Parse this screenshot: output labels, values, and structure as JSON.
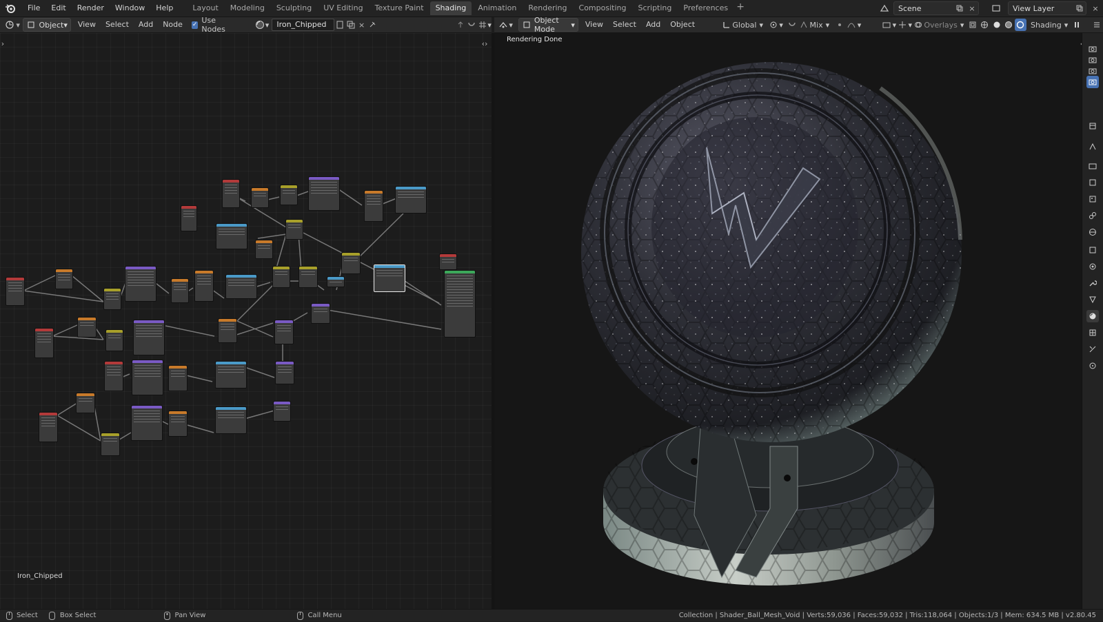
{
  "menu": [
    "File",
    "Edit",
    "Render",
    "Window",
    "Help"
  ],
  "workspaces": [
    "Layout",
    "Modeling",
    "Sculpting",
    "UV Editing",
    "Texture Paint",
    "Shading",
    "Animation",
    "Rendering",
    "Compositing",
    "Scripting",
    "Preferences"
  ],
  "active_workspace": "Shading",
  "scene": "Scene",
  "view_layer": "View Layer",
  "node_header": {
    "object_dd": "Object",
    "view": "View",
    "select": "Select",
    "add": "Add",
    "node": "Node",
    "use_nodes": "Use Nodes",
    "material": "Iron_Chipped"
  },
  "viewport_header": {
    "mode": "Object Mode",
    "view": "View",
    "select": "Select",
    "add": "Add",
    "object": "Object",
    "orientation": "Global",
    "blend": "Mix",
    "overlays": "Overlays",
    "shading": "Shading"
  },
  "viewport_status": "Rendering Done",
  "node_editor_label": "Iron_Chipped",
  "status": {
    "select": "Select",
    "box_select": "Box Select",
    "pan_view": "Pan View",
    "call_menu": "Call Menu",
    "info": "Collection | Shader_Ball_Mesh_Void | Verts:59,036 | Faces:59,032 | Tris:118,064 | Objects:1/3 | Mem: 634.5 MB | v2.80.45"
  },
  "colors": {
    "accent": "#4772b3",
    "active_tab": "#3d3d3d"
  }
}
